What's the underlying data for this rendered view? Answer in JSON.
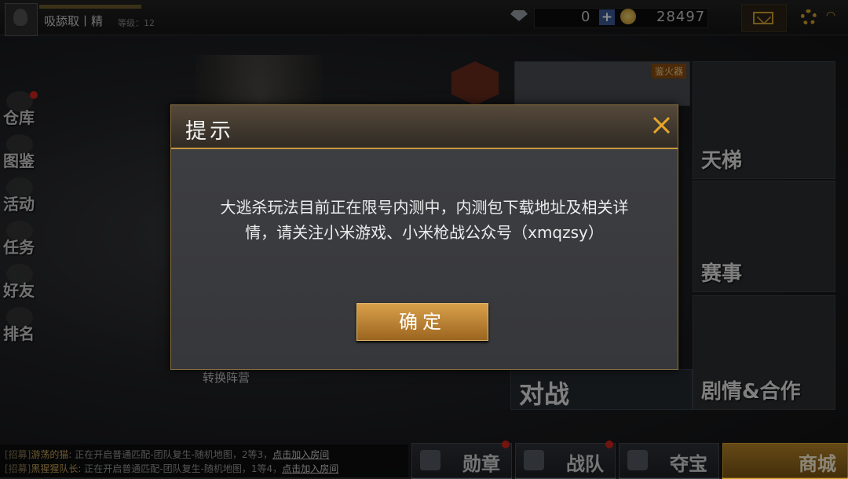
{
  "player": {
    "name": "吸舔取丨精",
    "level_text": "等级：12"
  },
  "currency": {
    "diamonds": "0",
    "coins": "28497"
  },
  "left_nav": [
    {
      "label": "仓库",
      "has_dot": true
    },
    {
      "label": "图鉴",
      "has_dot": false
    },
    {
      "label": "活动",
      "has_dot": false
    },
    {
      "label": "任务",
      "has_dot": false
    },
    {
      "label": "好友",
      "has_dot": false
    },
    {
      "label": "排名",
      "has_dot": false
    }
  ],
  "main": {
    "switch_camp": "转换阵营",
    "battle": "对战",
    "top_tile_tag": "鉴火器"
  },
  "right_tiles": {
    "ladder": "天梯",
    "event": "赛事",
    "story": "剧情&合作"
  },
  "chat": [
    {
      "channel": "[招募]",
      "name": "游荡的猫",
      "text": ": 正在开启普通匹配-团队复生-随机地图，2等3，",
      "link": "点击加入房间"
    },
    {
      "channel": "[招募]",
      "name": "黑猩猩队长",
      "text": ": 正在开启普通匹配-团队复生-随机地图，1等4，",
      "link": "点击加入房间"
    }
  ],
  "bottom_menu": {
    "medal": "勋章",
    "team": "战队",
    "treasure": "夺宝",
    "shop": "商城"
  },
  "dialog": {
    "title": "提示",
    "message": "大逃杀玩法目前正在限号内测中，内测包下载地址及相关详情，请关注小米游戏、小米枪战公众号（xmqzsy）",
    "ok": "确定"
  }
}
